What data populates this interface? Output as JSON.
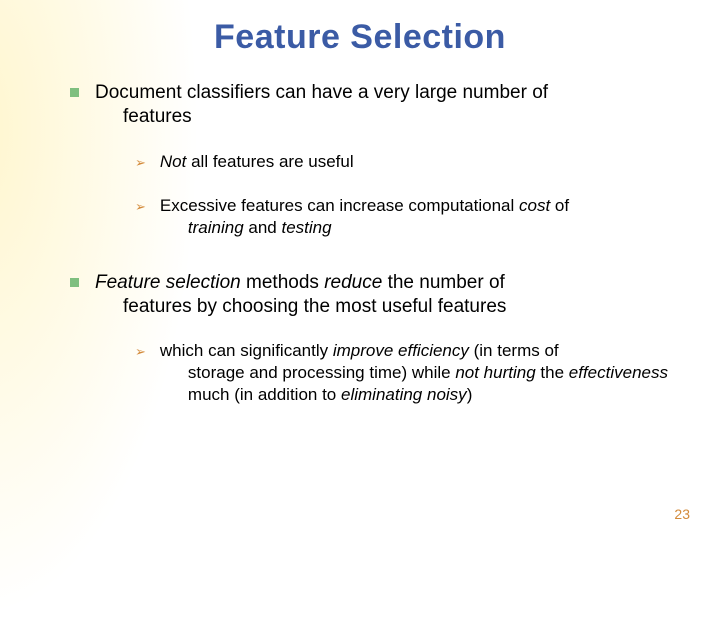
{
  "title": "Feature Selection",
  "bullets": {
    "b1": {
      "pre": "Document classifiers can have a very large number of ",
      "cont": "features"
    },
    "b1a": {
      "pre": "",
      "it1": "Not",
      "post": " all features are useful"
    },
    "b1b": {
      "pre": "Excessive features can increase computational ",
      "it1": "cost",
      "mid": " of ",
      "cont_it": "training",
      "cont_mid": " and ",
      "cont_it2": "testing"
    },
    "b2": {
      "it1": "Feature selection",
      "mid": " methods ",
      "it2": "reduce",
      "post": " the number of ",
      "cont": "features by choosing the most useful features"
    },
    "b2a": {
      "pre": "which can significantly ",
      "it1": "improve efficiency",
      "mid": " (in terms of ",
      "cont1": "storage and processing time) while ",
      "it2": "not hurting",
      "cont2": " the ",
      "it3": "effectiveness",
      "cont3": " much (in addition to ",
      "it4": "eliminating noisy",
      "cont4": ")"
    }
  },
  "pageNumber": "23"
}
